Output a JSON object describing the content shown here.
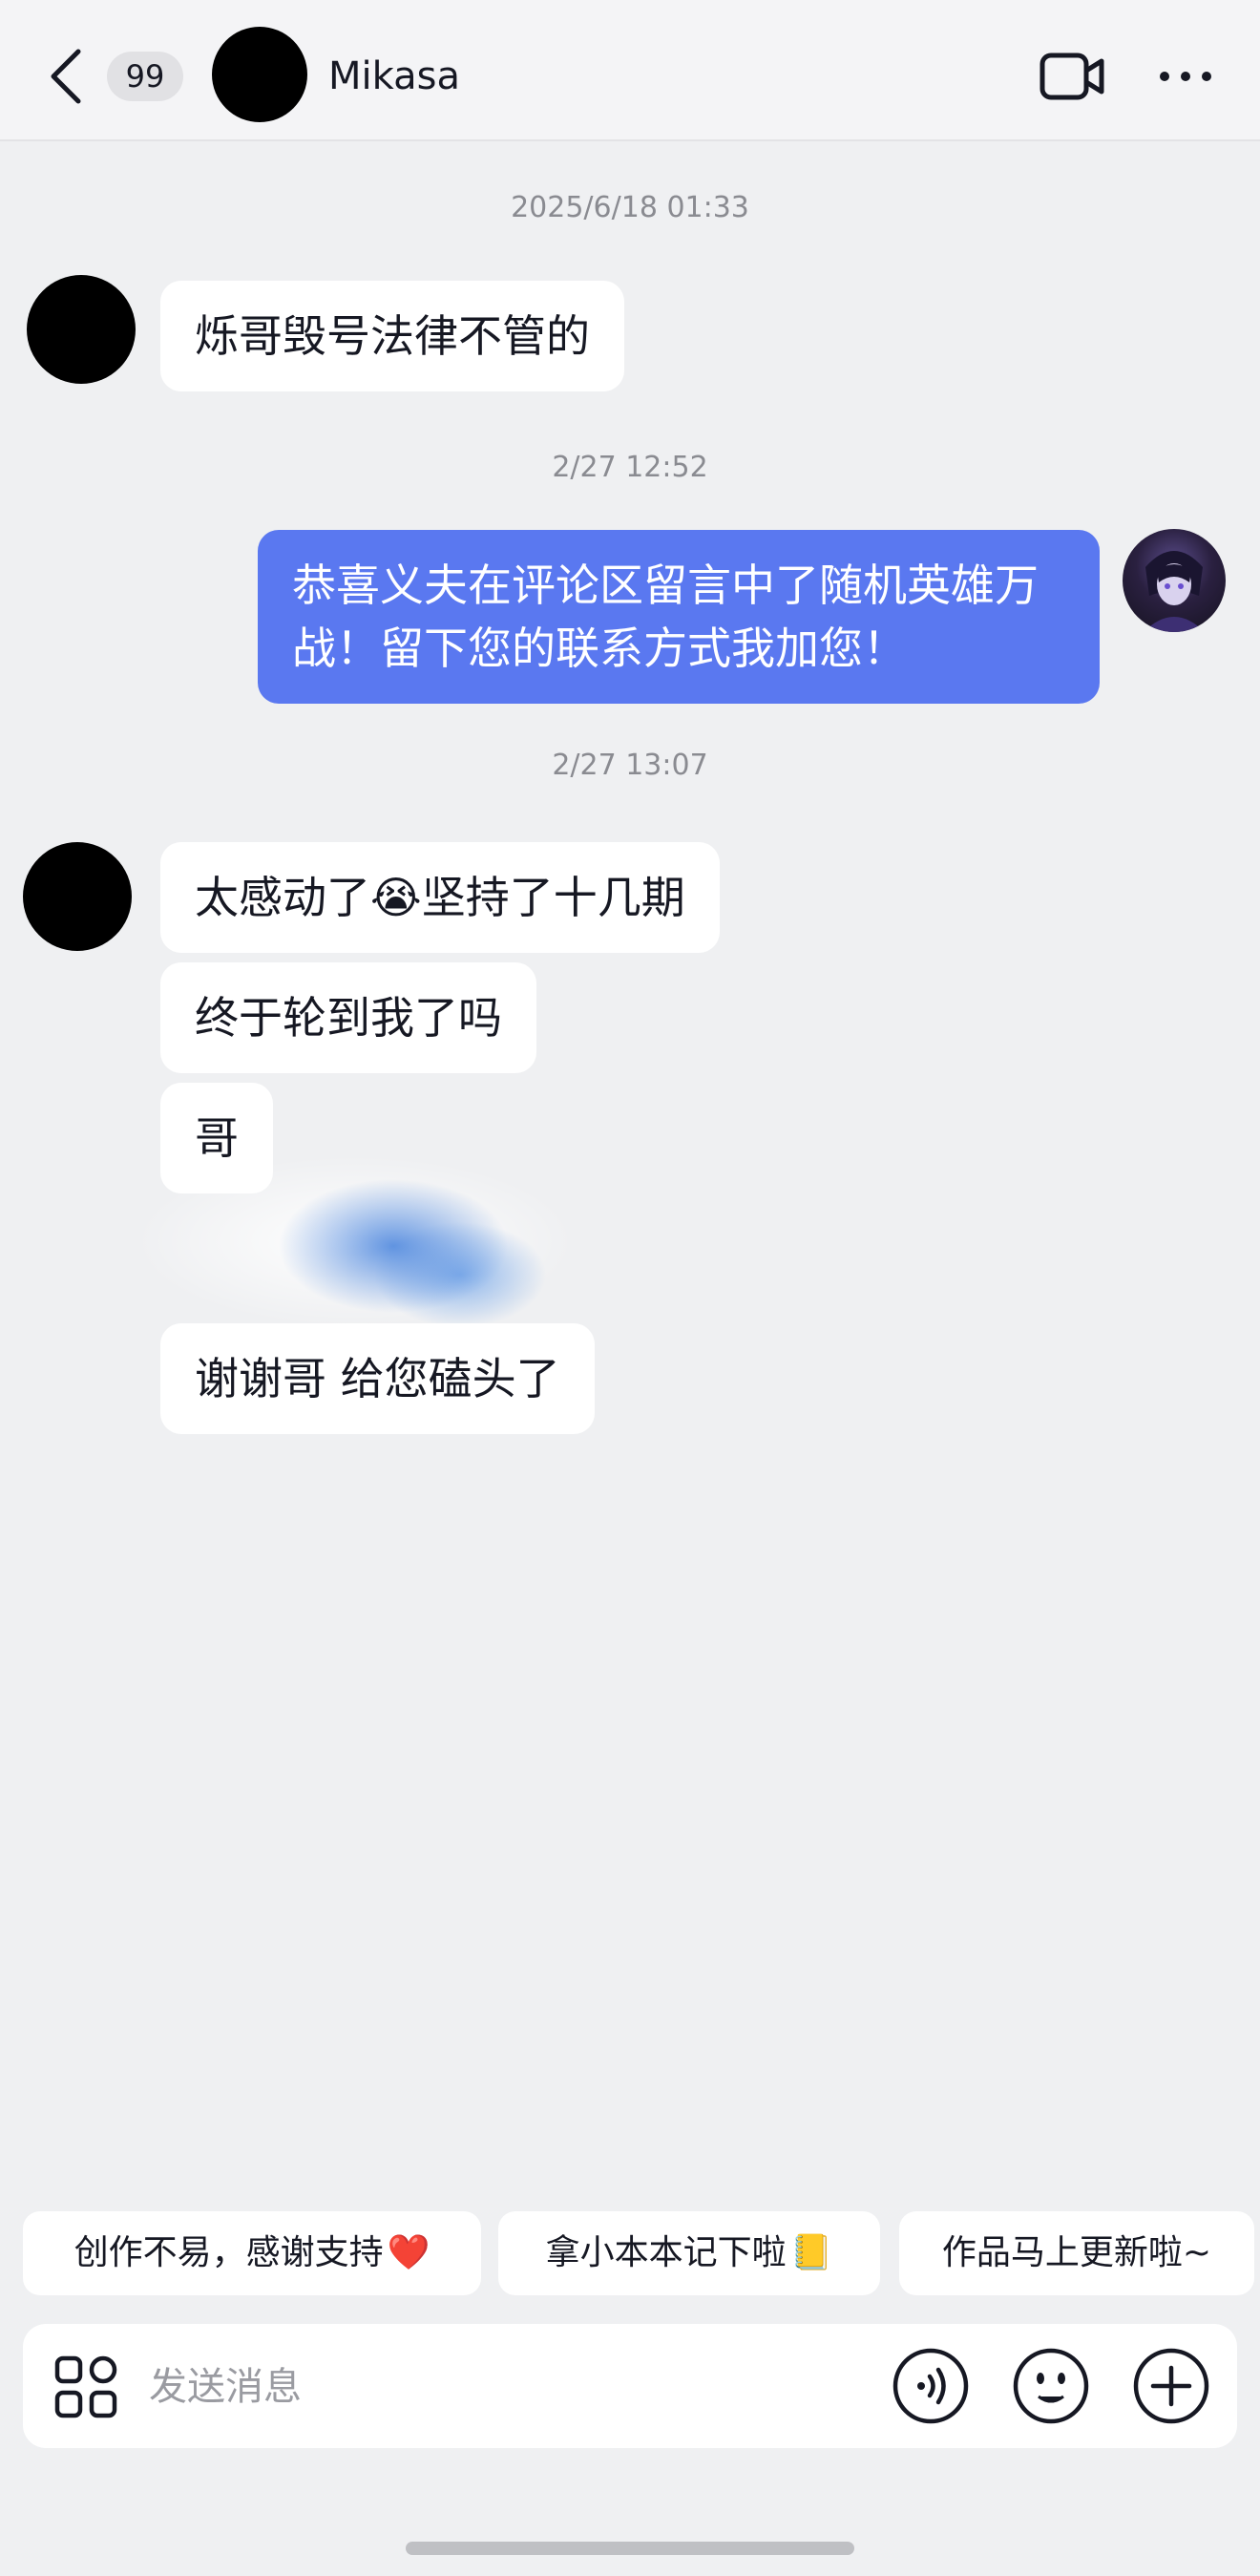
{
  "header": {
    "unread_count": "99",
    "contact_name": "Mikasa"
  },
  "chat": {
    "timestamps": [
      "2025/6/18 01:33",
      "2/27 12:52",
      "2/27 13:07"
    ],
    "messages": [
      {
        "from": "them",
        "text": "烁哥毁号法律不管的"
      },
      {
        "from": "me",
        "text": "恭喜义夫在评论区留言中了随机英雄万战！留下您的联系方式我加您！"
      },
      {
        "from": "them",
        "text_before": "太感动了",
        "emoji": "😭",
        "text_after": "坚持了十几期"
      },
      {
        "from": "them",
        "text": "终于轮到我了吗"
      },
      {
        "from": "them",
        "text": "哥"
      },
      {
        "from": "them",
        "text": "谢谢哥 给您磕头了"
      }
    ]
  },
  "quick_replies": [
    {
      "text": "创作不易，感谢支持",
      "emoji": "❤️"
    },
    {
      "text": "拿小本本记下啦",
      "emoji": "📒"
    },
    {
      "text": "作品马上更新啦~",
      "emoji": ""
    }
  ],
  "input": {
    "placeholder": "发送消息"
  },
  "colors": {
    "my_bubble": "#5a78f0",
    "background": "#eff0f2"
  },
  "icons": {
    "back": "chevron-left-icon",
    "video": "video-camera-icon",
    "more": "more-horizontal-icon",
    "apps": "apps-grid-icon",
    "voice": "voice-icon",
    "emoji": "emoji-face-icon",
    "add": "plus-circle-icon"
  }
}
